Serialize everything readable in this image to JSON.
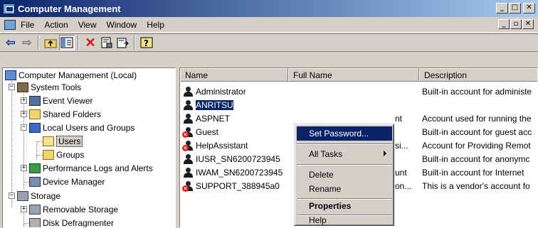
{
  "window": {
    "title": "Computer Management",
    "caption_buttons": [
      "_",
      "□",
      "✕"
    ]
  },
  "menubar": {
    "items": [
      "File",
      "Action",
      "View",
      "Window",
      "Help"
    ],
    "mdi_buttons": [
      "_",
      "▫",
      "✕"
    ]
  },
  "toolbar": {
    "icons": [
      "back-arrow-icon",
      "forward-arrow-icon",
      "up-folder-icon",
      "show-hide-tree-icon",
      "delete-icon",
      "properties-icon",
      "export-list-icon",
      "help-icon"
    ]
  },
  "tree": {
    "root": "Computer Management (Local)",
    "system_tools": "System Tools",
    "event_viewer": "Event Viewer",
    "shared_folders": "Shared Folders",
    "local_users": "Local Users and Groups",
    "users": "Users",
    "groups": "Groups",
    "perf_logs": "Performance Logs and Alerts",
    "device_manager": "Device Manager",
    "storage": "Storage",
    "removable_storage": "Removable Storage",
    "disk_defrag": "Disk Defragmenter"
  },
  "list": {
    "columns": [
      "Name",
      "Full Name",
      "Description"
    ],
    "rows": [
      {
        "name": "Administrator",
        "full": "",
        "desc": "Built-in account for administe",
        "disabled": false,
        "selected": false
      },
      {
        "name": "ANRITSU",
        "full": "",
        "desc": "",
        "disabled": false,
        "selected": true
      },
      {
        "name": "ASPNET",
        "full": "nt",
        "desc": "Account used for running the",
        "disabled": false,
        "selected": false
      },
      {
        "name": "Guest",
        "full": "",
        "desc": "Built-in account for guest acc",
        "disabled": true,
        "selected": false
      },
      {
        "name": "HelpAssistant",
        "full": "si...",
        "desc": "Account for Providing Remot",
        "disabled": true,
        "selected": false
      },
      {
        "name": "IUSR_SN6200723945",
        "full": "",
        "desc": "Built-in account for anonymc",
        "disabled": false,
        "selected": false
      },
      {
        "name": "IWAM_SN6200723945",
        "full": "unt",
        "desc": "Built-in account for Internet",
        "disabled": false,
        "selected": false
      },
      {
        "name": "SUPPORT_388945a0",
        "full": "on...",
        "desc": "This is a vendor's account fo",
        "disabled": true,
        "selected": false
      }
    ]
  },
  "context_menu": {
    "set_password": "Set Password...",
    "all_tasks": "All Tasks",
    "delete": "Delete",
    "rename": "Rename",
    "properties": "Properties",
    "help": "Help"
  },
  "colors": {
    "title_active": "#0a246a",
    "title_gradient_end": "#a6caf0",
    "face": "#d4d0c8",
    "selection": "#0a246a"
  }
}
